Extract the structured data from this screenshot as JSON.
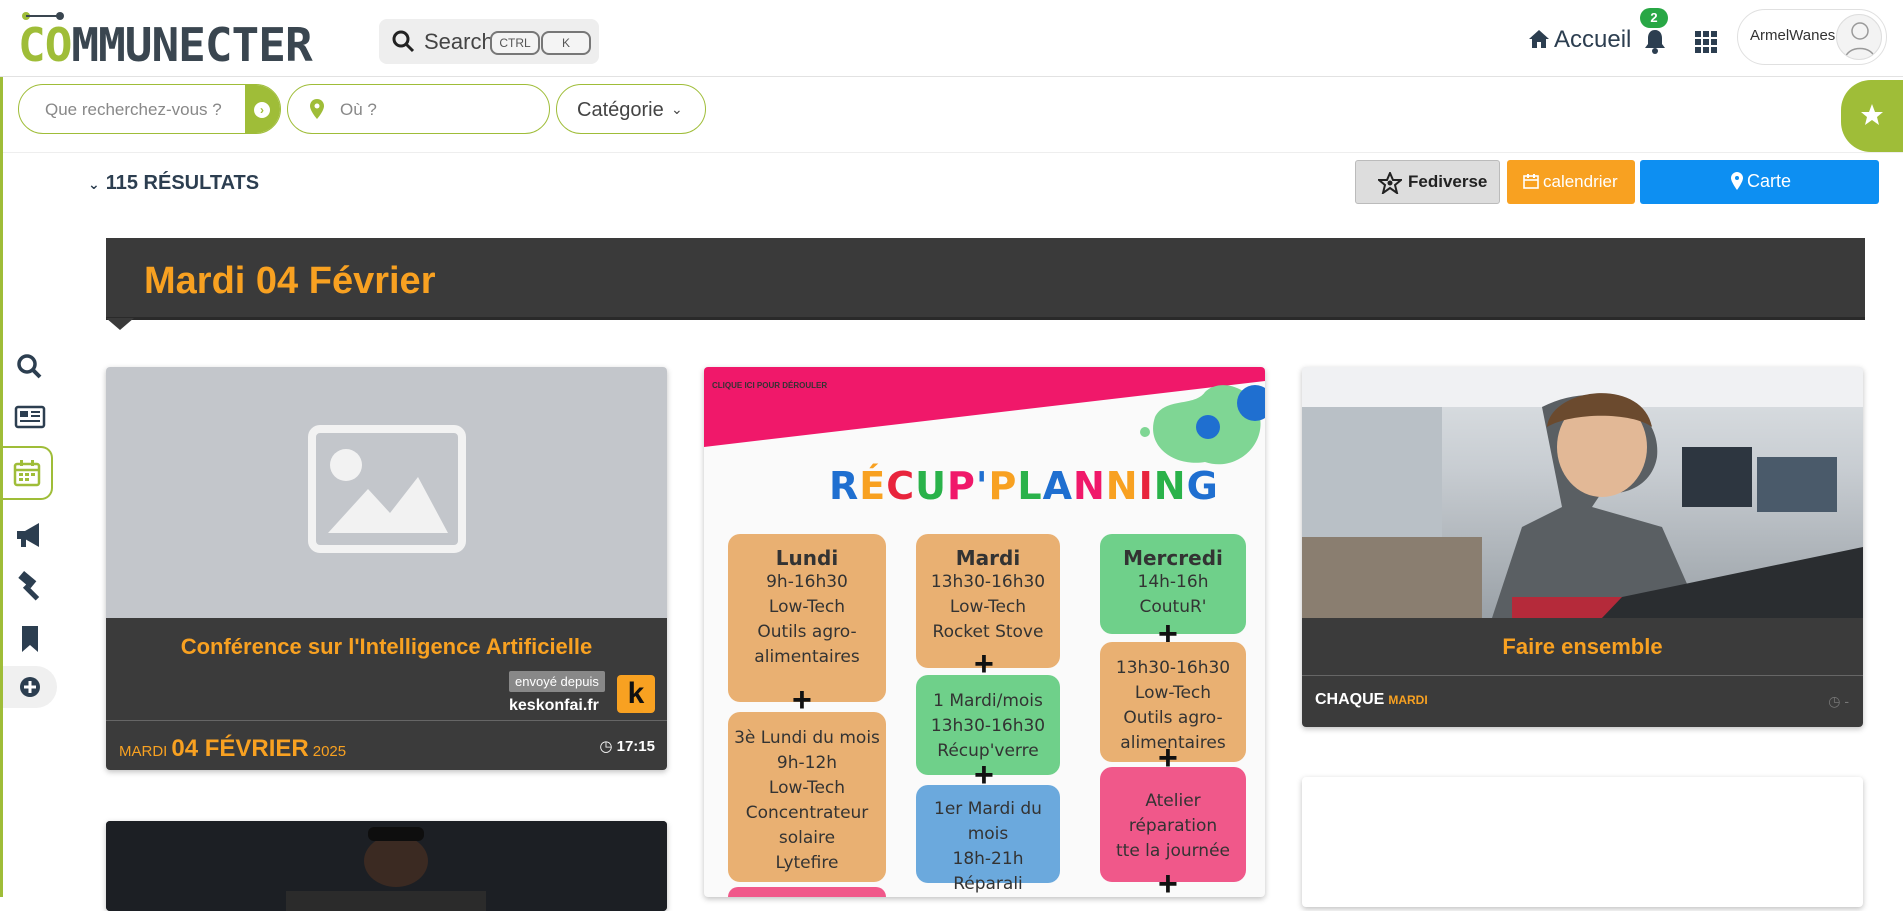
{
  "app": {
    "logo_text_a": "CO",
    "logo_text_b": "MMUNECTER",
    "search_label": "Search",
    "kbd_ctrl": "CTRL",
    "kbd_k": "K",
    "home_label": "Accueil",
    "notif_count": "2",
    "username": "ArmelWanes"
  },
  "filters": {
    "what_placeholder": "Que recherchez-vous ?",
    "where_placeholder": "Où ?",
    "category_label": "Catégorie"
  },
  "results": {
    "count_label": "115 RÉSULTATS",
    "fediverse_label": "Fediverse",
    "calendar_label": "calendrier",
    "map_label": "Carte"
  },
  "date_header": "Mardi 04 Février",
  "cards": {
    "conf": {
      "title": "Conférence sur l'Intelligence Artificielle",
      "sent_from": "envoyé depuis",
      "source": "keskonfai.fr",
      "source_logo": "k",
      "day_name": "MARDI",
      "day_main": "04 FÉVRIER",
      "year": "2025",
      "time": "17:15"
    },
    "planning": {
      "clique": "CLIQUE ICI POUR DÉROULER",
      "heading_letters": [
        "R",
        "É",
        "C",
        "U",
        "P",
        "'",
        "P",
        "L",
        "A",
        "N",
        "N",
        "I",
        "N",
        "G"
      ],
      "lundi": {
        "h": "Lundi",
        "lines": [
          "9h-16h30",
          "Low-Tech",
          "Outils agro-",
          "alimentaires"
        ]
      },
      "lundi2": {
        "lines": [
          "3è Lundi du mois",
          "9h-12h",
          "Low-Tech",
          "Concentrateur",
          "solaire",
          "Lytefire"
        ]
      },
      "mardi": {
        "h": "Mardi",
        "lines": [
          "13h30-16h30",
          "Low-Tech",
          "Rocket Stove"
        ]
      },
      "mardi2": {
        "lines": [
          "1 Mardi/mois",
          "13h30-16h30",
          "Récup'verre"
        ]
      },
      "mardi3": {
        "lines": [
          "1er Mardi du mois",
          "18h-21h",
          "Réparali"
        ]
      },
      "mercredi": {
        "h": "Mercredi",
        "lines": [
          "14h-16h",
          "CoutuR'"
        ]
      },
      "mercredi2": {
        "lines": [
          "13h30-16h30",
          "Low-Tech",
          "Outils agro-",
          "alimentaires"
        ]
      },
      "mercredi3": {
        "lines": [
          "Atelier",
          "réparation",
          "tte la journée"
        ]
      }
    },
    "faire": {
      "title": "Faire ensemble",
      "recurrence": "CHAQUE",
      "recurrence_day": "MARDI",
      "clock": "-"
    }
  },
  "colors": {
    "brand_green": "#9fbd38",
    "accent_orange": "#f8a121",
    "map_blue": "#0d8ff2",
    "dark": "#3b3b3b"
  },
  "icons": {
    "sidenav": [
      "search-icon",
      "newspaper-icon",
      "calendar-icon",
      "megaphone-icon",
      "hammer-icon",
      "bookmark-icon",
      "plus-circle-icon"
    ]
  }
}
